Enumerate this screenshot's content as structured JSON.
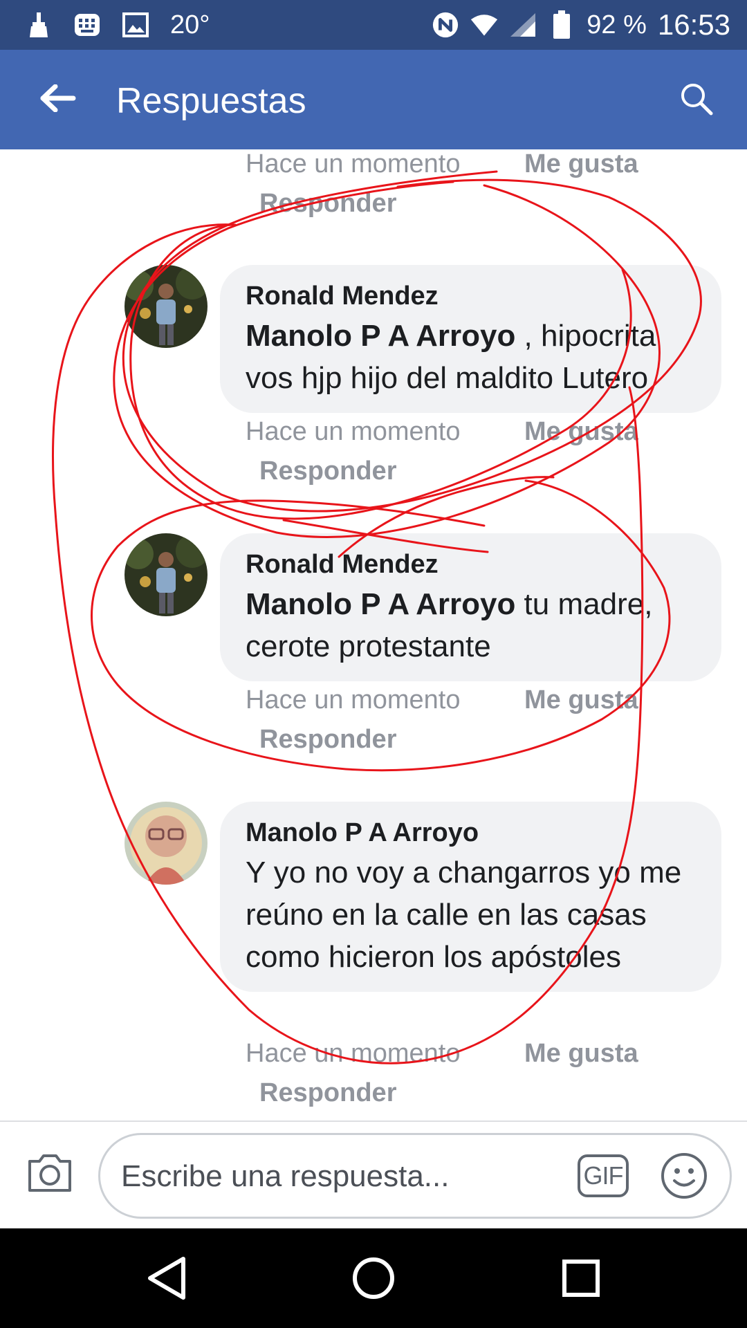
{
  "status_bar": {
    "temperature": "20°",
    "battery": "92 %",
    "time": "16:53"
  },
  "app_bar": {
    "title": "Respuestas"
  },
  "comments": [
    {
      "id": "c0",
      "partial": true,
      "time": "Hace un momento",
      "like": "Me gusta",
      "reply": "Responder"
    },
    {
      "id": "c1",
      "author": "Ronald Mendez",
      "mention": "Manolo P A Arroyo",
      "text": " , hipocrita vos hjp hijo del maldito Lutero",
      "time": "Hace un momento",
      "like": "Me gusta",
      "reply": "Responder"
    },
    {
      "id": "c2",
      "author": "Ronald Mendez",
      "mention": "Manolo P A Arroyo",
      "text": " tu madre, cerote protestante",
      "time": "Hace un momento",
      "like": "Me gusta",
      "reply": "Responder"
    },
    {
      "id": "c3",
      "author": "Manolo P A Arroyo",
      "mention": "",
      "text": "Y yo no voy a changarros yo me reúno en la calle en las casas como hicieron los apóstoles",
      "time": "Hace un momento",
      "like": "Me gusta",
      "reply": "Responder"
    }
  ],
  "composer": {
    "placeholder": "Escribe una respuesta...",
    "gif_label": "GIF"
  },
  "icons": {
    "back": "arrow-left-icon",
    "search": "search-icon",
    "camera": "camera-icon",
    "emoji": "smiley-icon"
  },
  "colors": {
    "status_bar": "#2f4a7f",
    "app_bar": "#4267b2",
    "annotation": "#e8141a",
    "bubble": "#f1f2f4",
    "meta": "#90949c"
  }
}
